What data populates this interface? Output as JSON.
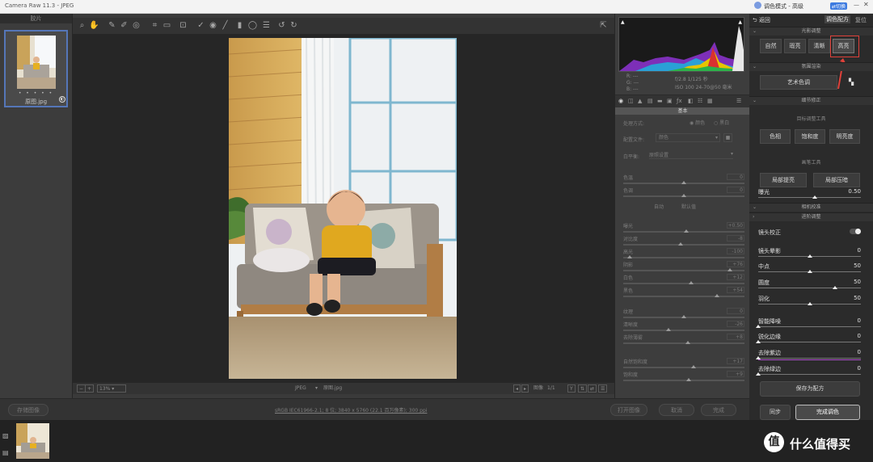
{
  "window": {
    "title": "Camera Raw 11.3 - JPEG"
  },
  "plugin_window": {
    "title": "调色模式 - 高级",
    "switch_label": "切换"
  },
  "filmstrip": {
    "header": "胶片",
    "stars": "• • • • •",
    "filename": "原图.jpg"
  },
  "canvas": {
    "zoom": "13%",
    "filename_label": "原图.jpg",
    "format": "JPEG",
    "page": "1/1",
    "workflow_link": "sRGB IEC61966-2.1; 8 位; 3840 x 5760 (22.1 百万像素); 300 ppi"
  },
  "bottom_buttons": {
    "save_image": "存储图像",
    "open_image": "打开图像",
    "cancel": "取消",
    "done": "完成"
  },
  "histogram": {
    "exif_line1": "f/2.8  1/125 秒",
    "exif_line2": "ISO 100  24-70@50 毫米",
    "rgb_r": "R: ---",
    "rgb_g": "G: ---",
    "rgb_b": "B: ---"
  },
  "basic_panel": {
    "header": "基本",
    "process_label": "处理方式:",
    "process_color": "颜色",
    "process_bw": "黑白",
    "profile_label": "配置文件:",
    "profile_value": "颜色",
    "wb_label": "白平衡:",
    "wb_value": "原照设置",
    "auto": "自动",
    "default": "默认值",
    "sliders": [
      {
        "label": "色温",
        "value": "0",
        "pos": 0.5
      },
      {
        "label": "色调",
        "value": "0",
        "pos": 0.5
      },
      {
        "label": "曝光",
        "value": "+0.50",
        "pos": 0.52
      },
      {
        "label": "对比度",
        "value": "-8",
        "pos": 0.47
      },
      {
        "label": "高光",
        "value": "-100",
        "pos": 0.05
      },
      {
        "label": "阴影",
        "value": "+76",
        "pos": 0.88
      },
      {
        "label": "白色",
        "value": "+12",
        "pos": 0.56
      },
      {
        "label": "黑色",
        "value": "+54",
        "pos": 0.77
      },
      {
        "label": "纹理",
        "value": "0",
        "pos": 0.5
      },
      {
        "label": "清晰度",
        "value": "-26",
        "pos": 0.37
      },
      {
        "label": "去除薄雾",
        "value": "+8",
        "pos": 0.53
      },
      {
        "label": "自然饱和度",
        "value": "+17",
        "pos": 0.58
      },
      {
        "label": "饱和度",
        "value": "+9",
        "pos": 0.54
      }
    ]
  },
  "plugin": {
    "back": "返回",
    "tab_toning": "调色配方",
    "tab_reset": "复位",
    "light_section": "光影调整",
    "light_buttons": [
      "自然",
      "瑕亮",
      "清晰",
      "高亮"
    ],
    "atmo_section": "氛围渲染",
    "atmo_button": "艺术色调",
    "detail_section": "细节修正",
    "target_tool": "目标调整工具",
    "target_buttons": [
      "色相",
      "饱和度",
      "明亮度"
    ],
    "brush_tool": "画笔工具",
    "brush_buttons": [
      "局部提亮",
      "局部压暗"
    ],
    "exposure": {
      "label": "曝光",
      "value": "0.50",
      "pos": 0.55
    },
    "camera_section": "相机校准",
    "advanced_section": "进阶调整",
    "lens_label": "镜头校正",
    "vignette": [
      {
        "label": "镜头晕影",
        "value": "0",
        "pos": 0.5
      },
      {
        "label": "中点",
        "value": "50",
        "pos": 0.5
      },
      {
        "label": "圆度",
        "value": "50",
        "pos": 0.75
      },
      {
        "label": "羽化",
        "value": "50",
        "pos": 0.5
      }
    ],
    "sharpen": [
      {
        "label": "智能降噪",
        "value": "0",
        "pos": 0.0
      },
      {
        "label": "锐化边缘",
        "value": "0",
        "pos": 0.0
      },
      {
        "label": "去除紫边",
        "value": "0",
        "pos": 0.0
      },
      {
        "label": "去除绿边",
        "value": "0",
        "pos": 0.0
      }
    ],
    "save_recipe": "保存为配方",
    "sync": "同步",
    "finish": "完成调色"
  },
  "watermark": {
    "logo": "值",
    "text": "什么值得买"
  },
  "colors": {
    "accent_red": "#e0413a",
    "selection_blue": "#5576b8",
    "fringe_purple": "#b04fd0"
  }
}
